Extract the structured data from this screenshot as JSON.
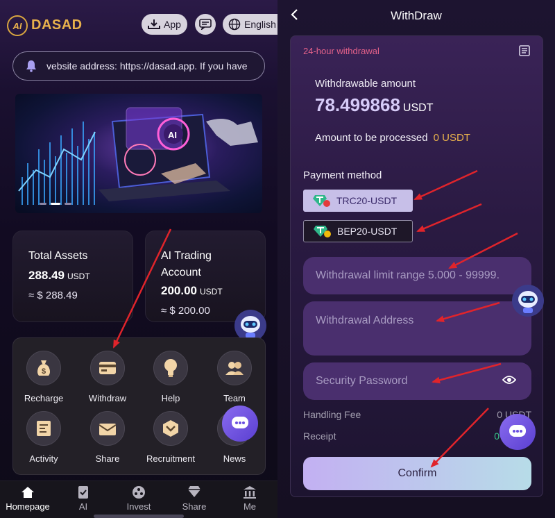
{
  "left": {
    "brand": {
      "logo_text": "AI",
      "name": "DASAD"
    },
    "header": {
      "app_label": "App",
      "lang_label": "English"
    },
    "notice": {
      "text": "vebsite address: https://dasad.app. If you have"
    },
    "cards": {
      "total_assets": {
        "title": "Total Assets",
        "value": "288.49",
        "unit": "USDT",
        "approx": "≈ $ 288.49"
      },
      "ai_trading": {
        "title_line1": "AI Trading",
        "title_line2": "Account",
        "value": "200.00",
        "unit": "USDT",
        "approx": "≈ $ 200.00"
      }
    },
    "menu": [
      {
        "label": "Recharge",
        "icon": "money-bag-icon"
      },
      {
        "label": "Withdraw",
        "icon": "card-icon"
      },
      {
        "label": "Help",
        "icon": "lightbulb-icon"
      },
      {
        "label": "Team",
        "icon": "team-icon"
      },
      {
        "label": "Activity",
        "icon": "activity-icon"
      },
      {
        "label": "Share",
        "icon": "share-icon"
      },
      {
        "label": "Recruitment",
        "icon": "recruitment-icon"
      },
      {
        "label": "News",
        "icon": "news-icon"
      }
    ],
    "tabs": [
      {
        "label": "Homepage",
        "icon": "home-icon"
      },
      {
        "label": "AI",
        "icon": "ai-icon"
      },
      {
        "label": "Invest",
        "icon": "invest-icon"
      },
      {
        "label": "Share",
        "icon": "diamond-icon"
      },
      {
        "label": "Me",
        "icon": "bank-icon"
      }
    ]
  },
  "right": {
    "title": "WithDraw",
    "notice_24h": "24-hour withdrawal",
    "withdrawable_label": "Withdrawable amount",
    "withdrawable_value": "78.499868",
    "withdrawable_unit": "USDT",
    "processing_label": "Amount to be processed",
    "processing_value": "0 USDT",
    "payment_method_label": "Payment method",
    "methods": [
      "TRC20-USDT",
      "BEP20-USDT"
    ],
    "limit_placeholder": "Withdrawal limit range 5.000 - 99999.",
    "address_placeholder": "Withdrawal Address",
    "password_placeholder": "Security Password",
    "handling_fee_label": "Handling Fee",
    "handling_fee_value": "0 USDT",
    "receipt_label": "Receipt",
    "receipt_value": "0",
    "confirm_label": "Confirm"
  },
  "colors": {
    "gold": "#e8b14c",
    "accent_purple": "#d6cbf8",
    "warn_pink": "#e5628a",
    "arrow_red": "#e0242b"
  }
}
